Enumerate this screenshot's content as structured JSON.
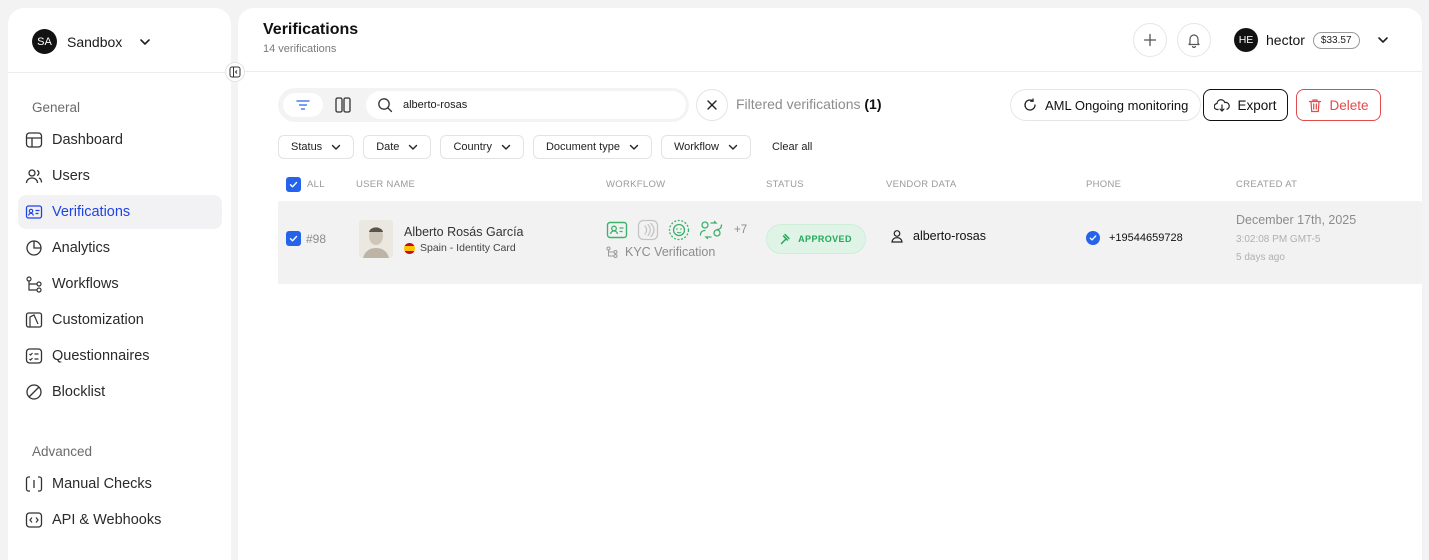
{
  "workspace": {
    "initials": "SA",
    "name": "Sandbox"
  },
  "sidebar": {
    "section_general": "General",
    "section_advanced": "Advanced",
    "items": [
      {
        "label": "Dashboard",
        "icon": "dashboard-icon"
      },
      {
        "label": "Users",
        "icon": "users-icon"
      },
      {
        "label": "Verifications",
        "icon": "id-card-icon",
        "active": true
      },
      {
        "label": "Analytics",
        "icon": "pie-chart-icon"
      },
      {
        "label": "Workflows",
        "icon": "workflow-icon"
      },
      {
        "label": "Customization",
        "icon": "palette-icon"
      },
      {
        "label": "Questionnaires",
        "icon": "checklist-icon"
      },
      {
        "label": "Blocklist",
        "icon": "block-icon"
      }
    ],
    "advanced_items": [
      {
        "label": "Manual Checks",
        "icon": "manual-check-icon"
      },
      {
        "label": "API & Webhooks",
        "icon": "code-icon"
      }
    ]
  },
  "header": {
    "title": "Verifications",
    "subtitle": "14 verifications",
    "user_initials": "HE",
    "user_name": "hector",
    "balance": "$33.57"
  },
  "toolbar": {
    "search_value": "alberto-rosas",
    "filtered_label": "Filtered verifications",
    "filtered_count": "(1)",
    "aml_label": "AML Ongoing monitoring",
    "export_label": "Export",
    "delete_label": "Delete"
  },
  "filters": [
    "Status",
    "Date",
    "Country",
    "Document type",
    "Workflow"
  ],
  "clear_all": "Clear all",
  "table": {
    "headers": {
      "all": "ALL",
      "user_name": "USER NAME",
      "workflow": "WORKFLOW",
      "status": "STATUS",
      "vendor_data": "VENDOR DATA",
      "phone": "PHONE",
      "created_at": "CREATED AT"
    },
    "rows": [
      {
        "id": "#98",
        "name": "Alberto Rosás García",
        "document": "Spain - Identity Card",
        "workflow_more": "+7",
        "workflow_name": "KYC Verification",
        "status": "APPROVED",
        "vendor_data": "alberto-rosas",
        "phone": "+19544659728",
        "created_date": "December 17th, 2025",
        "created_time": "3:02:08 PM GMT-5",
        "created_ago": "5 days ago"
      }
    ]
  },
  "colors": {
    "accent": "#1f44e6",
    "checkbox": "#2563eb",
    "approved": "#27a85a",
    "danger": "#e34a4a"
  }
}
